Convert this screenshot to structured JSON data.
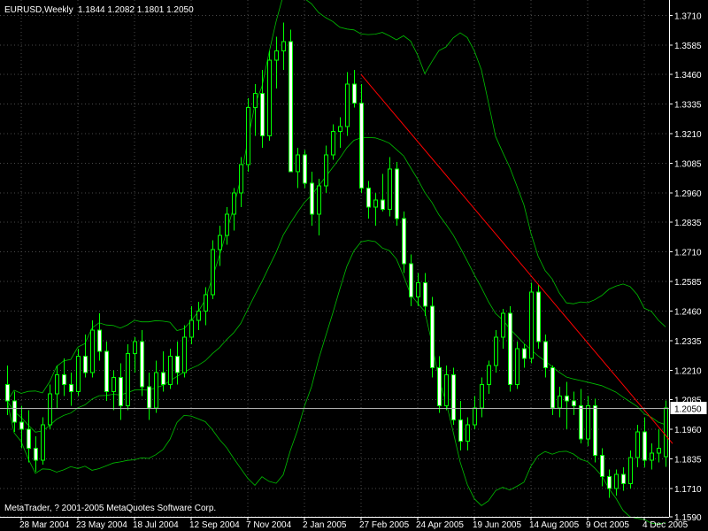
{
  "header": {
    "symbol": "EURUSD,Weekly",
    "ohlc": "1.1844 1.2082 1.1801 1.2050"
  },
  "copyright": "MetaTrader, ? 2001-2005 MetaQuotes Software Corp.",
  "colors": {
    "background": "#000000",
    "candle_outline": "#00ff00",
    "bullish_fill": "#000000",
    "bearish_fill": "#ffffff",
    "bands": "#00c000",
    "trendline": "#ff0000",
    "axis": "#ffffff",
    "grid": "#4a4a4a"
  },
  "chart_data": {
    "type": "candlestick",
    "title": "EURUSD,Weekly",
    "ylim": [
      1.159,
      1.3775
    ],
    "grid": true,
    "y_ticks": [
      "1.3710",
      "1.3585",
      "1.3460",
      "1.3335",
      "1.3210",
      "1.3085",
      "1.2960",
      "1.2835",
      "1.2710",
      "1.2585",
      "1.2460",
      "1.2335",
      "1.2210",
      "1.2085",
      "1.1960",
      "1.1835",
      "1.1710",
      "1.1590"
    ],
    "x_ticks": [
      "28 Mar 2004",
      "23 May 2004",
      "18 Jul 2004",
      "12 Sep 2004",
      "7 Nov 2004",
      "2 Jan 2005",
      "27 Feb 2005",
      "24 Apr 2005",
      "19 Jun 2005",
      "14 Aug 2005",
      "9 Oct 2005",
      "4 Dec 2005"
    ],
    "x_tick_bar_index": [
      2,
      10,
      18,
      26,
      34,
      42,
      50,
      58,
      66,
      74,
      82,
      90
    ],
    "current_price": "1.2050",
    "candles": [
      [
        1.215,
        1.223,
        1.202,
        1.208
      ],
      [
        1.208,
        1.212,
        1.195,
        1.199
      ],
      [
        1.199,
        1.206,
        1.188,
        1.196
      ],
      [
        1.196,
        1.204,
        1.182,
        1.188
      ],
      [
        1.188,
        1.193,
        1.178,
        1.183
      ],
      [
        1.183,
        1.201,
        1.181,
        1.198
      ],
      [
        1.198,
        1.215,
        1.196,
        1.211
      ],
      [
        1.211,
        1.223,
        1.205,
        1.219
      ],
      [
        1.219,
        1.226,
        1.21,
        1.215
      ],
      [
        1.215,
        1.22,
        1.206,
        1.212
      ],
      [
        1.212,
        1.23,
        1.21,
        1.227
      ],
      [
        1.227,
        1.236,
        1.218,
        1.22
      ],
      [
        1.22,
        1.242,
        1.218,
        1.238
      ],
      [
        1.238,
        1.245,
        1.225,
        1.229
      ],
      [
        1.229,
        1.233,
        1.208,
        1.212
      ],
      [
        1.212,
        1.221,
        1.204,
        1.218
      ],
      [
        1.218,
        1.224,
        1.2,
        1.206
      ],
      [
        1.206,
        1.232,
        1.204,
        1.228
      ],
      [
        1.228,
        1.235,
        1.22,
        1.233
      ],
      [
        1.233,
        1.238,
        1.21,
        1.214
      ],
      [
        1.214,
        1.22,
        1.2,
        1.205
      ],
      [
        1.205,
        1.225,
        1.203,
        1.22
      ],
      [
        1.22,
        1.229,
        1.212,
        1.215
      ],
      [
        1.215,
        1.23,
        1.213,
        1.227
      ],
      [
        1.227,
        1.233,
        1.215,
        1.22
      ],
      [
        1.22,
        1.24,
        1.218,
        1.235
      ],
      [
        1.235,
        1.248,
        1.232,
        1.242
      ],
      [
        1.242,
        1.25,
        1.238,
        1.246
      ],
      [
        1.246,
        1.256,
        1.24,
        1.253
      ],
      [
        1.253,
        1.276,
        1.251,
        1.272
      ],
      [
        1.272,
        1.282,
        1.265,
        1.278
      ],
      [
        1.278,
        1.29,
        1.274,
        1.287
      ],
      [
        1.287,
        1.298,
        1.28,
        1.296
      ],
      [
        1.296,
        1.311,
        1.29,
        1.308
      ],
      [
        1.308,
        1.336,
        1.305,
        1.332
      ],
      [
        1.332,
        1.342,
        1.32,
        1.338
      ],
      [
        1.338,
        1.348,
        1.315,
        1.32
      ],
      [
        1.32,
        1.356,
        1.318,
        1.352
      ],
      [
        1.352,
        1.362,
        1.34,
        1.356
      ],
      [
        1.356,
        1.368,
        1.348,
        1.36
      ],
      [
        1.36,
        1.365,
        1.318,
        1.305
      ],
      [
        1.305,
        1.315,
        1.298,
        1.312
      ],
      [
        1.312,
        1.314,
        1.298,
        1.3
      ],
      [
        1.3,
        1.305,
        1.282,
        1.287
      ],
      [
        1.287,
        1.302,
        1.278,
        1.299
      ],
      [
        1.299,
        1.316,
        1.296,
        1.312
      ],
      [
        1.312,
        1.325,
        1.31,
        1.322
      ],
      [
        1.322,
        1.328,
        1.315,
        1.324
      ],
      [
        1.324,
        1.347,
        1.32,
        1.342
      ],
      [
        1.342,
        1.348,
        1.332,
        1.334
      ],
      [
        1.334,
        1.342,
        1.296,
        1.298
      ],
      [
        1.298,
        1.301,
        1.285,
        1.29
      ],
      [
        1.29,
        1.296,
        1.282,
        1.293
      ],
      [
        1.293,
        1.304,
        1.288,
        1.289
      ],
      [
        1.289,
        1.311,
        1.286,
        1.306
      ],
      [
        1.306,
        1.309,
        1.282,
        1.285
      ],
      [
        1.285,
        1.288,
        1.262,
        1.266
      ],
      [
        1.266,
        1.27,
        1.248,
        1.252
      ],
      [
        1.252,
        1.262,
        1.248,
        1.258
      ],
      [
        1.258,
        1.262,
        1.244,
        1.248
      ],
      [
        1.248,
        1.252,
        1.218,
        1.222
      ],
      [
        1.222,
        1.227,
        1.203,
        1.206
      ],
      [
        1.206,
        1.223,
        1.204,
        1.219
      ],
      [
        1.219,
        1.222,
        1.198,
        1.2
      ],
      [
        1.2,
        1.208,
        1.187,
        1.191
      ],
      [
        1.191,
        1.201,
        1.187,
        1.198
      ],
      [
        1.198,
        1.21,
        1.196,
        1.205
      ],
      [
        1.205,
        1.218,
        1.201,
        1.215
      ],
      [
        1.215,
        1.225,
        1.211,
        1.223
      ],
      [
        1.223,
        1.238,
        1.22,
        1.235
      ],
      [
        1.235,
        1.247,
        1.23,
        1.245
      ],
      [
        1.245,
        1.248,
        1.212,
        1.215
      ],
      [
        1.215,
        1.233,
        1.213,
        1.23
      ],
      [
        1.23,
        1.232,
        1.222,
        1.226
      ],
      [
        1.226,
        1.258,
        1.224,
        1.254
      ],
      [
        1.254,
        1.257,
        1.23,
        1.233
      ],
      [
        1.233,
        1.236,
        1.218,
        1.222
      ],
      [
        1.222,
        1.223,
        1.202,
        1.205
      ],
      [
        1.205,
        1.214,
        1.201,
        1.21
      ],
      [
        1.21,
        1.216,
        1.196,
        1.208
      ],
      [
        1.208,
        1.212,
        1.202,
        1.206
      ],
      [
        1.206,
        1.213,
        1.19,
        1.192
      ],
      [
        1.192,
        1.21,
        1.189,
        1.206
      ],
      [
        1.206,
        1.209,
        1.182,
        1.185
      ],
      [
        1.185,
        1.188,
        1.172,
        1.176
      ],
      [
        1.176,
        1.179,
        1.167,
        1.171
      ],
      [
        1.171,
        1.179,
        1.168,
        1.177
      ],
      [
        1.177,
        1.18,
        1.17,
        1.173
      ],
      [
        1.173,
        1.187,
        1.171,
        1.184
      ],
      [
        1.184,
        1.198,
        1.18,
        1.195
      ],
      [
        1.195,
        1.201,
        1.18,
        1.183
      ],
      [
        1.183,
        1.19,
        1.179,
        1.186
      ],
      [
        1.186,
        1.196,
        1.182,
        1.188
      ],
      [
        1.1844,
        1.2082,
        1.1801,
        1.205
      ]
    ],
    "trendline": {
      "from_bar": 50,
      "from_price": 1.346,
      "to_bar": 94,
      "to_price": 1.19
    }
  }
}
